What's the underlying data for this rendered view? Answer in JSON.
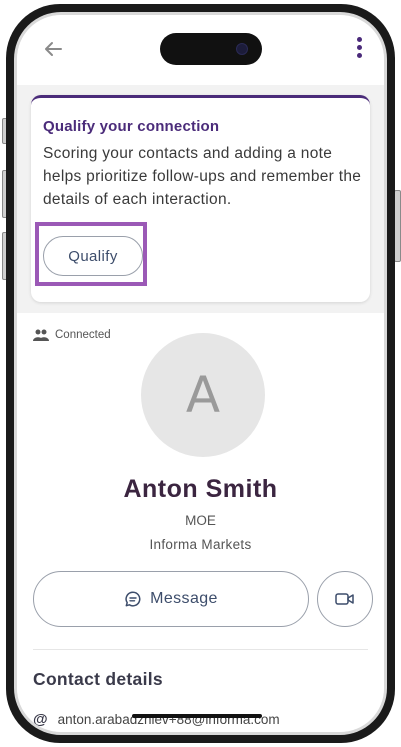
{
  "icons": {
    "back": "back-arrow-icon",
    "menu": "kebab-menu-icon",
    "connected": "people-icon",
    "message": "chat-bubble-icon",
    "video": "video-call-icon",
    "email": "at-sign-icon"
  },
  "colors": {
    "accent": "#4b2c7a",
    "highlight": "#9b59b6",
    "button_text": "#3d4d6b"
  },
  "qualify": {
    "title": "Qualify your connection",
    "description": "Scoring your contacts and adding a note helps prioritize follow-ups and remember the details of each interaction.",
    "button_label": "Qualify"
  },
  "profile": {
    "status": "Connected",
    "avatar_initial": "A",
    "name": "Anton Smith",
    "role": "MOE",
    "company": "Informa Markets",
    "message_label": "Message"
  },
  "contact_details": {
    "title": "Contact details",
    "email_symbol": "@",
    "email": "anton.arabadzhiev+88@informa.com"
  }
}
